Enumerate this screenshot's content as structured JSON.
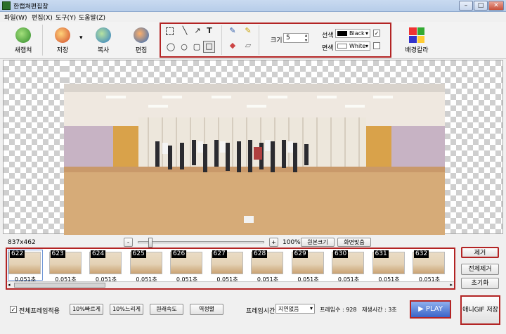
{
  "window": {
    "title": "한캡쳐편집창",
    "buttons": [
      "–",
      "□",
      "✕"
    ]
  },
  "menu": [
    "파일(W)",
    "편집(X)",
    "도구(Y)",
    "도움말(Z)"
  ],
  "toolbar": {
    "new_capture": "새캡쳐",
    "save": "저장",
    "save_dropdown": "▾",
    "copy": "복사",
    "edit": "편집",
    "size_label": "크기",
    "size_value": "5",
    "line_color_label": "선색",
    "line_color_value": "Black",
    "fill_color_label": "면색",
    "fill_color_value": "White",
    "bg_color": "배경칼라"
  },
  "image_size": "837x462",
  "zoom": {
    "minus": "-",
    "plus": "+",
    "percent": "100%",
    "original_size": "원본크기",
    "fit_screen": "화면맞춤",
    "slider_fraction": 0.08
  },
  "frames": [
    {
      "num": "622",
      "delay": "0.051초"
    },
    {
      "num": "623",
      "delay": "0.051초"
    },
    {
      "num": "624",
      "delay": "0.051초"
    },
    {
      "num": "625",
      "delay": "0.051초"
    },
    {
      "num": "626",
      "delay": "0.051초"
    },
    {
      "num": "627",
      "delay": "0.051초"
    },
    {
      "num": "628",
      "delay": "0.051초"
    },
    {
      "num": "629",
      "delay": "0.051초"
    },
    {
      "num": "630",
      "delay": "0.051초"
    },
    {
      "num": "631",
      "delay": "0.051초"
    },
    {
      "num": "632",
      "delay": "0.051초"
    }
  ],
  "side_buttons": {
    "remove": "제거",
    "remove_all": "전체제거",
    "reset": "초기화"
  },
  "bottom": {
    "apply_all_label": "전체프레임적용",
    "apply_all_checked": "✓",
    "faster": "10%빠르게",
    "slower": "10%느리게",
    "original_speed": "원래속도",
    "reverse": "역정렬",
    "frame_time_label": "프레임시간",
    "frame_time_value": "지연없음",
    "frame_count": "프레임수 : 928",
    "play_time": "재생시간 : 3초",
    "play": "▶ PLAY",
    "save_gif": "애니GIF 저장"
  },
  "colors": {
    "accent_red": "#b32424",
    "play_blue": "#4a76d6"
  }
}
